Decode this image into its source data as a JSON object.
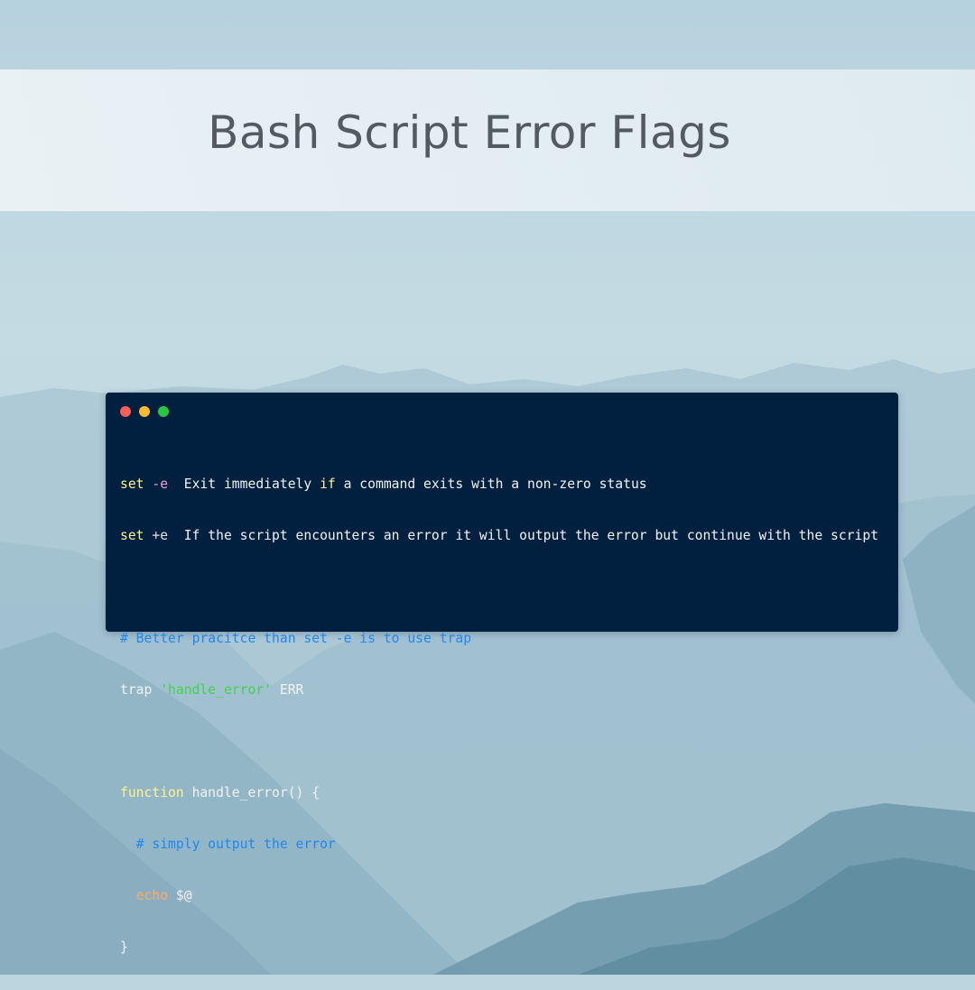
{
  "title": "Bash Script Error Flags",
  "colors": {
    "terminal_bg": "#01203f",
    "title_text": "#545b60",
    "keyword": "#fef48a",
    "flag": "#e79fe0",
    "comment": "#1f88ee",
    "string": "#3fd44a",
    "builtin": "#ffab66",
    "plain": "#f1f3f5"
  },
  "window_controls": [
    "close-dot",
    "minimize-dot",
    "maximize-dot"
  ],
  "code": {
    "line1": {
      "kw": "set",
      "flag": "-e",
      "pre": "  Exit immediately ",
      "kw2": "if",
      "post": " a command exits with a non-zero status"
    },
    "line2": {
      "kw": "set",
      "flag": "+e",
      "text": "  If the script encounters an error it will output the error but continue with the script"
    },
    "line4": {
      "comment": "# Better pracitce than set -e is to use trap"
    },
    "line5": {
      "cmd": "trap",
      "string": "'handle_error'",
      "arg": "ERR"
    },
    "line7": {
      "kw": "function",
      "rest": " handle_error() {"
    },
    "line8": {
      "comment": "# simply output the error"
    },
    "line9": {
      "kw": "echo",
      "arg": "$@"
    },
    "line10": {
      "brace": "}"
    }
  }
}
